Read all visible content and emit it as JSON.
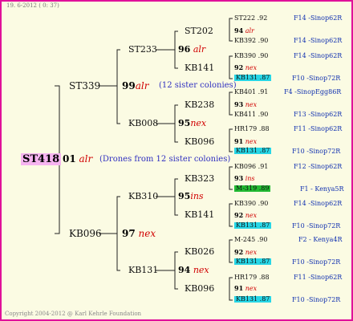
{
  "header_text": "19. 6-2012 ( 0: 37)",
  "copyright": "Copyright 2004-2012 @ Karl Kehrle Foundation",
  "root": {
    "id": "ST418",
    "generation": "01",
    "code": "alr",
    "note": "(Drones from 12 sister colonies)"
  },
  "gen1": [
    {
      "id": "ST339",
      "num": "99",
      "code": "alr",
      "note": "(12 sister colonies)"
    },
    {
      "id": "KB096",
      "num": "97",
      "code": "nex"
    }
  ],
  "gen2": [
    {
      "id": "ST233",
      "num": "96",
      "code": "alr"
    },
    {
      "id": "KB008",
      "num": "95",
      "code": "nex"
    },
    {
      "id": "KB310",
      "num": "95",
      "code": "ins"
    },
    {
      "id": "KB131",
      "num": "94",
      "code": "nex"
    }
  ],
  "gen3": [
    {
      "id": "ST202",
      "num": "94",
      "code": "alr"
    },
    {
      "id": "KB141",
      "num": "92",
      "code": "nex"
    },
    {
      "id": "KB238",
      "num": "93",
      "code": "nex"
    },
    {
      "id": "KB096",
      "num": "91",
      "code": "nex"
    },
    {
      "id": "KB323",
      "num": "93",
      "code": "ins"
    },
    {
      "id": "KB141",
      "num": "92",
      "code": "nex"
    },
    {
      "id": "KB026",
      "num": "92",
      "code": "nex"
    },
    {
      "id": "KB096",
      "num": "91",
      "code": "nex"
    }
  ],
  "gen4": [
    {
      "id": "ST222 .92",
      "loc": "F14 -Sinop62R",
      "hl": ""
    },
    {
      "id": "KB392 .90",
      "loc": "F14 -Sinop62R",
      "hl": ""
    },
    {
      "id": "KB390 .90",
      "loc": "F14 -Sinop62R",
      "hl": ""
    },
    {
      "id": "KB131 .87",
      "loc": "F10 -Sinop72R",
      "hl": "cyan"
    },
    {
      "id": "KB401 .91",
      "loc": "F4 -SinopEgg86R",
      "hl": ""
    },
    {
      "id": "KB411 .90",
      "loc": "F13 -Sinop62R",
      "hl": ""
    },
    {
      "id": "HR179 .88",
      "loc": "F11 -Sinop62R",
      "hl": ""
    },
    {
      "id": "KB131 .87",
      "loc": "F10 -Sinop72R",
      "hl": "cyan"
    },
    {
      "id": "KB096 .91",
      "loc": "F12 -Sinop62R",
      "hl": ""
    },
    {
      "id": "M-319 .89",
      "loc": "F1 - Kenya5R",
      "hl": "green"
    },
    {
      "id": "KB390 .90",
      "loc": "F14 -Sinop62R",
      "hl": ""
    },
    {
      "id": "KB131 .87",
      "loc": "F10 -Sinop72R",
      "hl": "cyan"
    },
    {
      "id": "M-245 .90",
      "loc": "F2 - Kenya4R",
      "hl": ""
    },
    {
      "id": "KB131 .87",
      "loc": "F10 -Sinop72R",
      "hl": "cyan"
    },
    {
      "id": "HR179 .88",
      "loc": "F11 -Sinop62R",
      "hl": ""
    },
    {
      "id": "KB131 .87",
      "loc": "F10 -Sinop72R",
      "hl": "cyan"
    }
  ]
}
